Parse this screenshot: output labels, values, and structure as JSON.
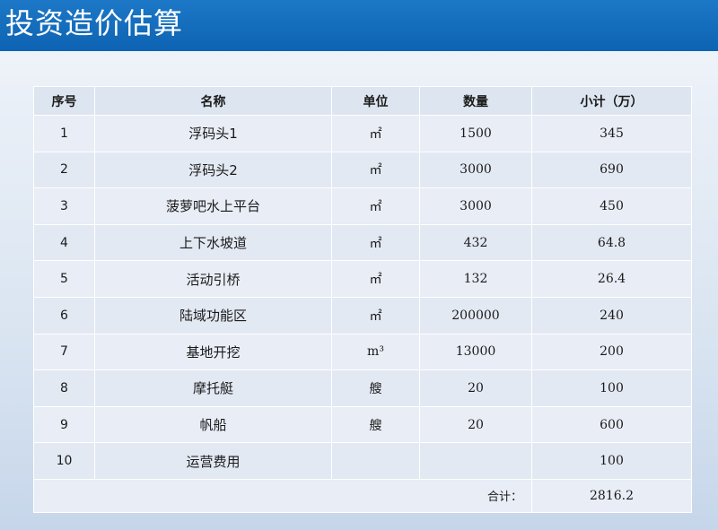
{
  "page": {
    "title": "投资造价估算"
  },
  "table": {
    "headers": [
      "序号",
      "名称",
      "单位",
      "数量",
      "小计（万）"
    ],
    "rows": [
      {
        "no": "1",
        "name": "浮码头1",
        "unit": "㎡",
        "qty": "1500",
        "subtotal": "345"
      },
      {
        "no": "2",
        "name": "浮码头2",
        "unit": "㎡",
        "qty": "3000",
        "subtotal": "690"
      },
      {
        "no": "3",
        "name": "菠萝吧水上平台",
        "unit": "㎡",
        "qty": "3000",
        "subtotal": "450"
      },
      {
        "no": "4",
        "name": "上下水坡道",
        "unit": "㎡",
        "qty": "432",
        "subtotal": "64.8"
      },
      {
        "no": "5",
        "name": "活动引桥",
        "unit": "㎡",
        "qty": "132",
        "subtotal": "26.4"
      },
      {
        "no": "6",
        "name": "陆域功能区",
        "unit": "㎡",
        "qty": "200000",
        "subtotal": "240"
      },
      {
        "no": "7",
        "name": "基地开挖",
        "unit": "m³",
        "qty": "13000",
        "subtotal": "200"
      },
      {
        "no": "8",
        "name": "摩托艇",
        "unit": "艘",
        "qty": "20",
        "subtotal": "100"
      },
      {
        "no": "9",
        "name": "帆船",
        "unit": "艘",
        "qty": "20",
        "subtotal": "600"
      },
      {
        "no": "10",
        "name": "运营费用",
        "unit": "",
        "qty": "",
        "subtotal": "100"
      }
    ],
    "total_label": "合计：",
    "total_value": "2816.2"
  },
  "colors": {
    "title_bar": "#0e63b3",
    "title_text": "#ffffff",
    "table_bg": "#e6ecf5",
    "grid_line": "#ffffff"
  }
}
